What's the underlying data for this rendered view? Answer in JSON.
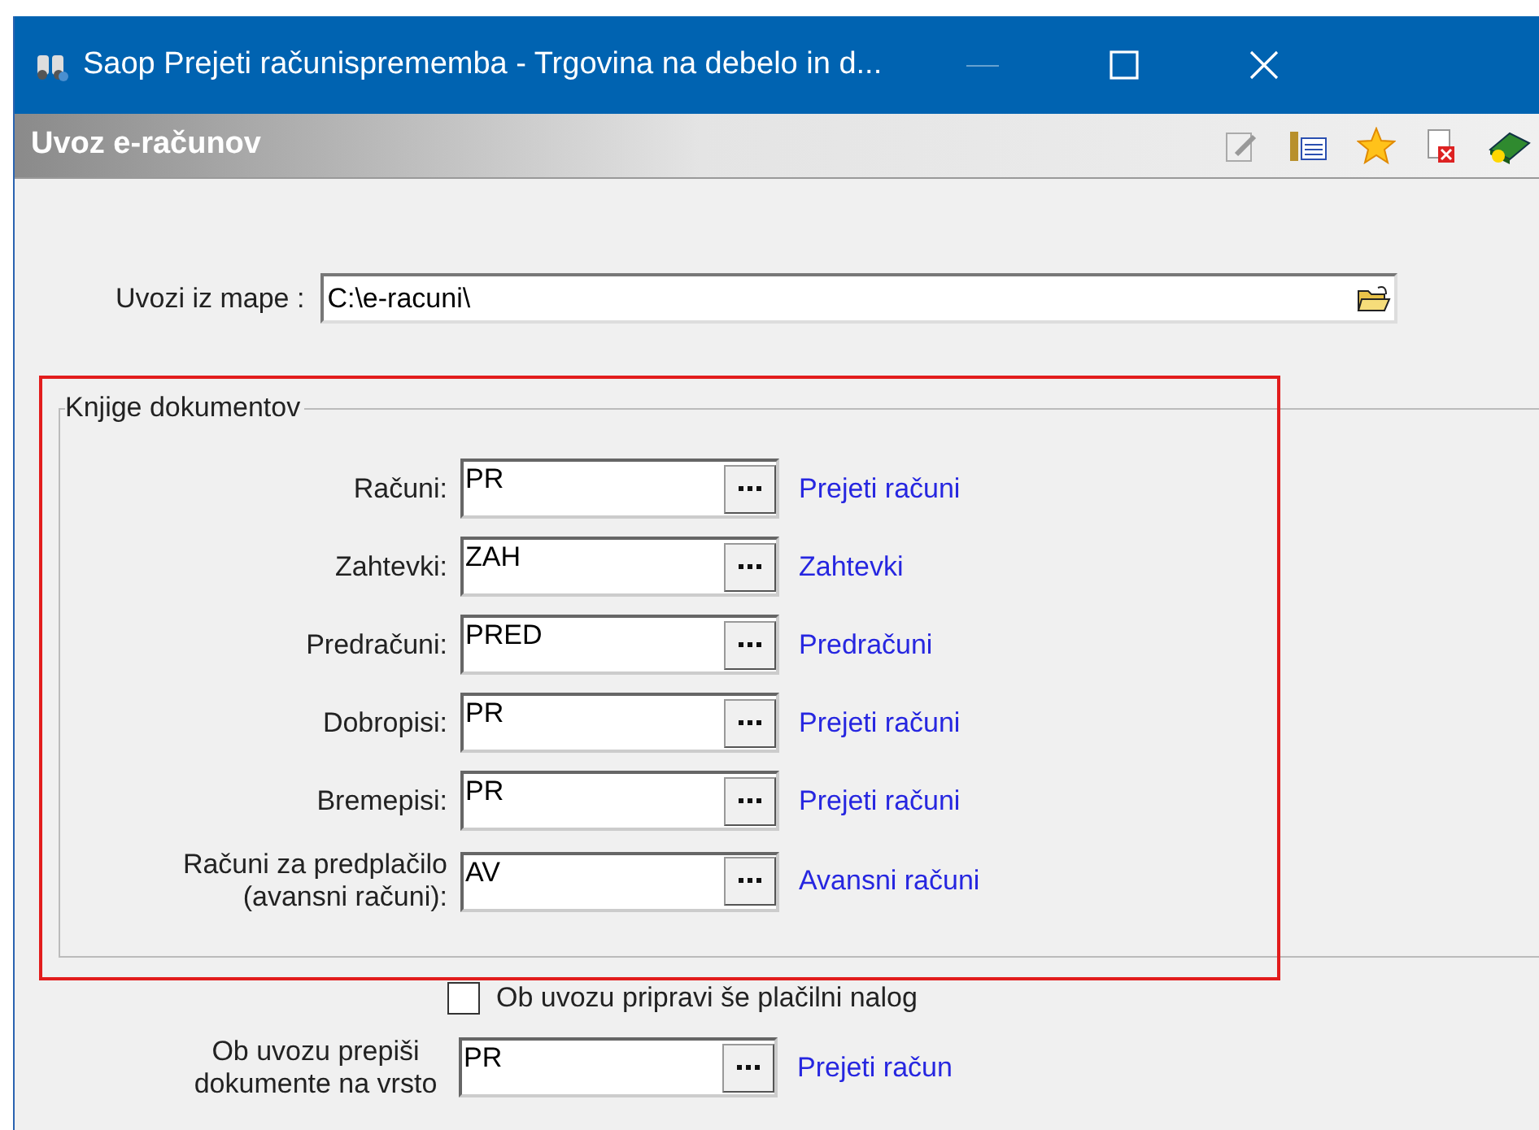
{
  "window": {
    "title": "Saop Prejeti računisprememba - Trgovina na debelo in d..."
  },
  "header": {
    "title": "Uvoz e-računov"
  },
  "folder": {
    "label": "Uvozi iz mape :",
    "value": "C:\\e-racuni\\"
  },
  "group": {
    "title": "Knjige dokumentov",
    "rows": [
      {
        "label": "Računi:",
        "value": "PR",
        "link": "Prejeti računi"
      },
      {
        "label": "Zahtevki:",
        "value": "ZAH",
        "link": "Zahtevki"
      },
      {
        "label": "Predračuni:",
        "value": "PRED",
        "link": "Predračuni"
      },
      {
        "label": "Dobropisi:",
        "value": "PR",
        "link": "Prejeti računi"
      },
      {
        "label": "Bremepisi:",
        "value": "PR",
        "link": "Prejeti računi"
      },
      {
        "label": "Računi za predplačilo (avansni računi):",
        "value": "AV",
        "link": "Avansni računi"
      }
    ]
  },
  "payment_order": {
    "label": "Ob uvozu pripravi še plačilni nalog",
    "checked": false
  },
  "rewrite": {
    "label": "Ob uvozu prepiši dokumente na vrsto",
    "value": "PR",
    "link": "Prejeti račun"
  }
}
